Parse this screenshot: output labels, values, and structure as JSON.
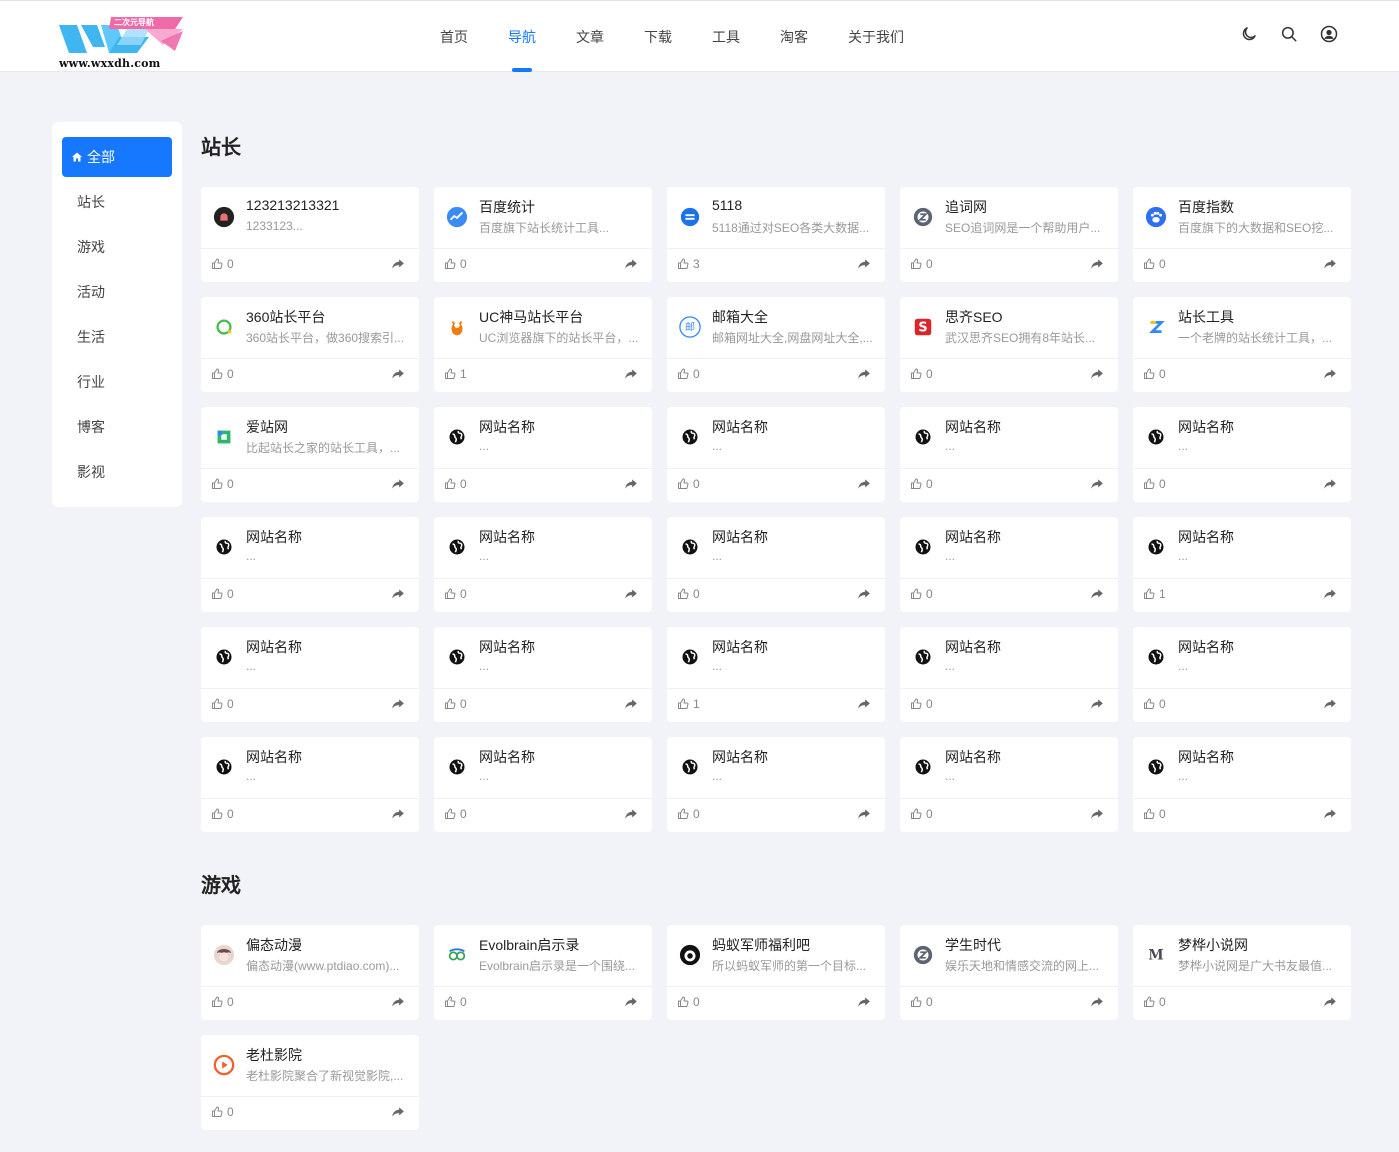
{
  "header": {
    "logo_text": "WXX",
    "logo_badge": "二次元导航",
    "logo_url": "www.wxxdh.com",
    "nav": [
      {
        "label": "首页",
        "active": false
      },
      {
        "label": "导航",
        "active": true
      },
      {
        "label": "文章",
        "active": false
      },
      {
        "label": "下载",
        "active": false
      },
      {
        "label": "工具",
        "active": false
      },
      {
        "label": "淘客",
        "active": false
      },
      {
        "label": "关于我们",
        "active": false
      }
    ],
    "tools": [
      "moon-icon",
      "search-icon",
      "user-icon"
    ]
  },
  "sidebar": {
    "items": [
      {
        "label": "全部",
        "active": true
      },
      {
        "label": "站长"
      },
      {
        "label": "游戏"
      },
      {
        "label": "活动"
      },
      {
        "label": "生活"
      },
      {
        "label": "行业"
      },
      {
        "label": "博客"
      },
      {
        "label": "影视"
      }
    ]
  },
  "sections": [
    {
      "title": "站长",
      "cards": [
        {
          "name": "123213213321",
          "desc": "1233123...",
          "likes": "0",
          "icon": "circle-logo-icon",
          "color": "#222"
        },
        {
          "name": "百度统计",
          "desc": "百度旗下站长统计工具...",
          "likes": "0",
          "icon": "chart-line-icon",
          "color": "#3c8af5"
        },
        {
          "name": "5118",
          "desc": "5118通过对SEO各类大数据...",
          "likes": "3",
          "icon": "5118-logo-icon",
          "color": "#1a73e8"
        },
        {
          "name": "追词网",
          "desc": "SEO追词网是一个帮助用户...",
          "likes": "0",
          "icon": "z-logo-icon",
          "color": "#5b6470"
        },
        {
          "name": "百度指数",
          "desc": "百度旗下的大数据和SEO挖...",
          "likes": "0",
          "icon": "paw-icon",
          "color": "#2f6ff2"
        },
        {
          "name": "360站长平台",
          "desc": "360站长平台，做360搜索引...",
          "likes": "0",
          "icon": "ring-logo-icon",
          "color": "#46c04b"
        },
        {
          "name": "UC神马站长平台",
          "desc": "UC浏览器旗下的站长平台，...",
          "likes": "1",
          "icon": "squirrel-icon",
          "color": "#f07c12"
        },
        {
          "name": "邮箱大全",
          "desc": "邮箱网址大全,网盘网址大全,...",
          "likes": "0",
          "icon": "mail-logo-icon",
          "color": "#3d8cf5"
        },
        {
          "name": "思齐SEO",
          "desc": "武汉思齐SEO拥有8年站长...",
          "likes": "0",
          "icon": "s-logo-icon",
          "color": "#d8262c"
        },
        {
          "name": "站长工具",
          "desc": "一个老牌的站长统计工具，...",
          "likes": "0",
          "icon": "z-colorful-icon",
          "color": "#2e8cf0"
        },
        {
          "name": "爱站网",
          "desc": "比起站长之家的站长工具，...",
          "likes": "0",
          "icon": "aizhan-logo-icon",
          "color": "#2bb86a"
        },
        {
          "name": "网站名称",
          "desc": "...",
          "likes": "0",
          "icon": "globe-icon",
          "color": "#111"
        },
        {
          "name": "网站名称",
          "desc": "...",
          "likes": "0",
          "icon": "globe-icon",
          "color": "#111"
        },
        {
          "name": "网站名称",
          "desc": "...",
          "likes": "0",
          "icon": "globe-icon",
          "color": "#111"
        },
        {
          "name": "网站名称",
          "desc": "...",
          "likes": "0",
          "icon": "globe-icon",
          "color": "#111"
        },
        {
          "name": "网站名称",
          "desc": "...",
          "likes": "0",
          "icon": "globe-icon",
          "color": "#111"
        },
        {
          "name": "网站名称",
          "desc": "...",
          "likes": "0",
          "icon": "globe-icon",
          "color": "#111"
        },
        {
          "name": "网站名称",
          "desc": "...",
          "likes": "0",
          "icon": "globe-icon",
          "color": "#111"
        },
        {
          "name": "网站名称",
          "desc": "...",
          "likes": "0",
          "icon": "globe-icon",
          "color": "#111"
        },
        {
          "name": "网站名称",
          "desc": "...",
          "likes": "1",
          "icon": "globe-icon",
          "color": "#111"
        },
        {
          "name": "网站名称",
          "desc": "...",
          "likes": "0",
          "icon": "globe-icon",
          "color": "#111"
        },
        {
          "name": "网站名称",
          "desc": "...",
          "likes": "0",
          "icon": "globe-icon",
          "color": "#111"
        },
        {
          "name": "网站名称",
          "desc": "...",
          "likes": "1",
          "icon": "globe-icon",
          "color": "#111"
        },
        {
          "name": "网站名称",
          "desc": "...",
          "likes": "0",
          "icon": "globe-icon",
          "color": "#111"
        },
        {
          "name": "网站名称",
          "desc": "...",
          "likes": "0",
          "icon": "globe-icon",
          "color": "#111"
        },
        {
          "name": "网站名称",
          "desc": "...",
          "likes": "0",
          "icon": "globe-icon",
          "color": "#111"
        },
        {
          "name": "网站名称",
          "desc": "...",
          "likes": "0",
          "icon": "globe-icon",
          "color": "#111"
        },
        {
          "name": "网站名称",
          "desc": "...",
          "likes": "0",
          "icon": "globe-icon",
          "color": "#111"
        },
        {
          "name": "网站名称",
          "desc": "...",
          "likes": "0",
          "icon": "globe-icon",
          "color": "#111"
        },
        {
          "name": "网站名称",
          "desc": "...",
          "likes": "0",
          "icon": "globe-icon",
          "color": "#111"
        }
      ]
    },
    {
      "title": "游戏",
      "cards": [
        {
          "name": "偏态动漫",
          "desc": "偏态动漫(www.ptdiao.com)...",
          "likes": "0",
          "icon": "anime-avatar-icon",
          "color": "#6b4a4a"
        },
        {
          "name": "Evolbrain启示录",
          "desc": "Evolbrain启示录是一个围绕...",
          "likes": "0",
          "icon": "goggles-icon",
          "color": "#3aa35a"
        },
        {
          "name": "蚂蚁军师福利吧",
          "desc": "所以蚂蚁军师的第一个目标...",
          "likes": "0",
          "icon": "ant-avatar-icon",
          "color": "#111"
        },
        {
          "name": "学生时代",
          "desc": "娱乐天地和情感交流的网上...",
          "likes": "0",
          "icon": "z-logo-icon",
          "color": "#5b6470"
        },
        {
          "name": "梦桦小说网",
          "desc": "梦桦小说网是广大书友最值...",
          "likes": "0",
          "icon": "m-letter-icon",
          "color": "#4a4a5a"
        },
        {
          "name": "老杜影院",
          "desc": "老杜影院聚合了新视觉影院,...",
          "likes": "0",
          "icon": "play-circle-icon",
          "color": "#f0612d"
        }
      ]
    }
  ],
  "colors": {
    "accent": "#1677ff",
    "background": "#f1f3f8",
    "card": "#ffffff"
  }
}
